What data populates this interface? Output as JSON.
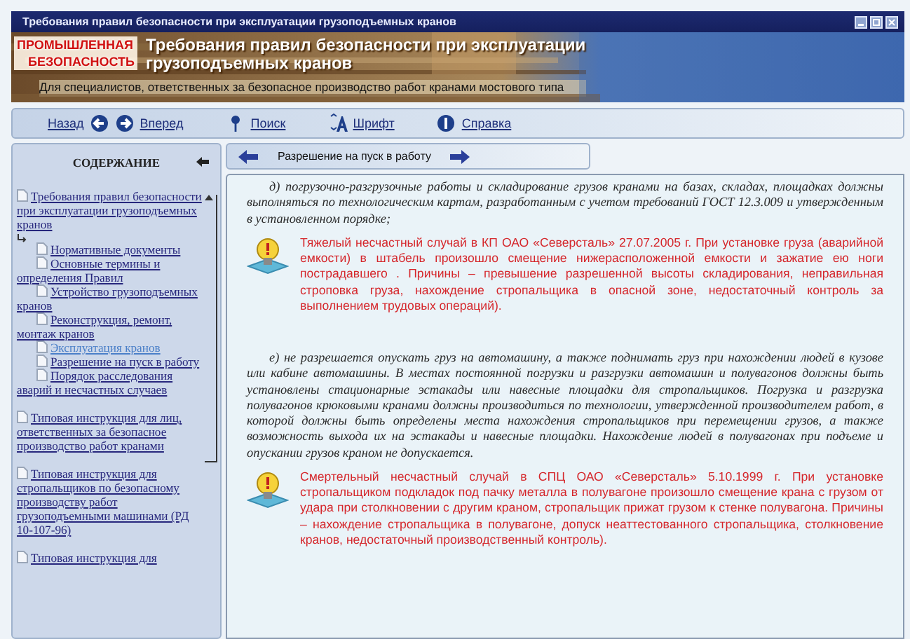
{
  "window": {
    "title": "Требования правил безопасности при эксплуатации грузоподъемных кранов"
  },
  "banner": {
    "logo": [
      "ПРОМЫШЛЕННАЯ",
      "БЕЗОПАСНОСТЬ"
    ],
    "title_lines": [
      "Требования правил безопасности при эксплуатации",
      "грузоподъемных кранов"
    ],
    "subtitle": "Для специалистов, ответственных за безопасное производство работ кранами мостового типа"
  },
  "toolbar": [
    {
      "kind": "back",
      "label": "Назад"
    },
    {
      "kind": "forward",
      "label": "Вперед"
    },
    {
      "kind": "search",
      "label": "Поиск"
    },
    {
      "kind": "font",
      "label": "Шрифт"
    },
    {
      "kind": "help",
      "label": "Справка"
    }
  ],
  "sidebar": {
    "title": "СОДЕРЖАНИЕ",
    "items": [
      {
        "label": "Требования правил безопасности при эксплуатации грузоподъемных кранов",
        "selected": false,
        "children": [
          {
            "label": "Нормативные документы",
            "selected": false
          },
          {
            "label": "Основные термины и определения Правил",
            "selected": false
          },
          {
            "label": "Устройство грузоподъемных кранов",
            "selected": false
          },
          {
            "label": "Реконструкция, ремонт, монтаж кранов",
            "selected": false
          },
          {
            "label": "Эксплуатация кранов",
            "selected": true
          },
          {
            "label": "Разрешение на пуск в работу",
            "selected": false
          },
          {
            "label": "Порядок расследования аварий и несчастных случаев",
            "selected": false
          }
        ]
      },
      {
        "label": "Типовая инструкция для лиц, ответственных за безопасное производство работ кранами",
        "selected": false
      },
      {
        "label": "Типовая инструкция для стропальщиков по безопасному производству работ грузоподъемными машинами (РД 10-107-96)",
        "selected": false
      },
      {
        "label": "Типовая инструкция для",
        "selected": false
      }
    ]
  },
  "content": {
    "section_title": "Разрешение на пуск в работу",
    "blocks": [
      {
        "kind": "paragraph",
        "text": "д) погрузочно-разгрузочные работы и складирование грузов кранами на базах, складах, площадках должны выполняться по технологическим картам, разработанным с учетом требований ГОСТ 12.3.009 и утвержденным в установленном порядке;"
      },
      {
        "kind": "warning",
        "text": "Тяжелый несчастный случай в КП ОАО «Северсталь» 27.07.2005 г. При установке груза (аварийной емкости) в штабель произошло смещение нижерасположенной емкости и зажатие ею ноги пострадавшего . Причины – превышение разрешенной высоты складирования, неправильная строповка груза, нахождение стропальщика в опасной зоне, недостаточный контроль за выполнением трудовых операций)."
      },
      {
        "kind": "paragraph",
        "text": "е) не разрешается опускать груз на автомашину, а также поднимать груз при нахождении людей в кузове или кабине автомашины. В местах постоянной погрузки и разгрузки автомашин и полувагонов должны быть установлены стационарные эстакады или навесные площадки для стропальщиков. Погрузка и разгрузка полувагонов крюковыми кранами должны производиться по технологии, утвержденной производителем работ, в которой должны быть определены места нахождения стропальщиков при перемещении грузов, а также возможность выхода их на эстакады и навесные площадки. Нахождение людей в полувагонах при подъеме и опускании грузов краном не допускается."
      },
      {
        "kind": "warning",
        "text": "Смертельный несчастный случай в СПЦ ОАО «Северсталь» 5.10.1999 г. При установке стропальщиком подкладок под пачку металла в полувагоне произошло смещение крана с грузом от удара при столкновении с другим краном, стропальщик прижат грузом к стенке полувагона. Причины – нахождение стропальщика в полувагоне, допуск неаттестованного стропальщика, столкновение кранов, недостаточный производственный контроль)."
      }
    ]
  }
}
